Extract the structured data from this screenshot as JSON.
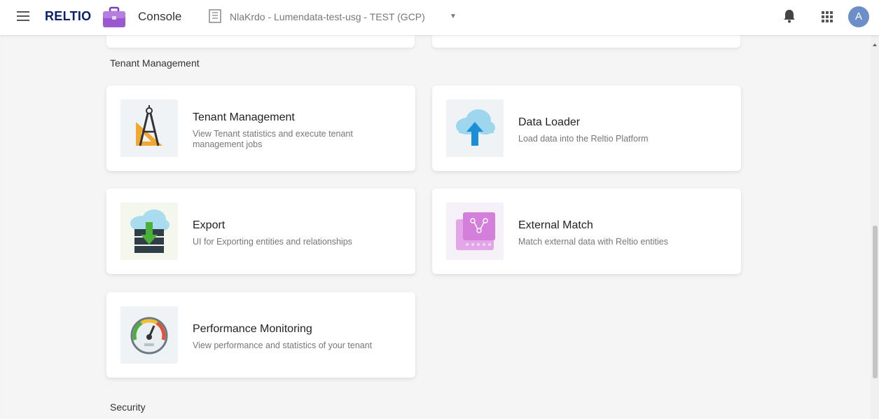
{
  "header": {
    "brand": "RELTIO",
    "app_name": "Console",
    "tenant_name": "NlaKrdo - Lumendata-test-usg - TEST (GCP)",
    "avatar_initial": "A"
  },
  "sections": [
    {
      "title": "Tenant Management",
      "cards": [
        {
          "title": "Tenant Management",
          "description": "View Tenant statistics and execute tenant management jobs",
          "icon": "compass-ruler-icon"
        },
        {
          "title": "Data Loader",
          "description": "Load data into the Reltio Platform",
          "icon": "cloud-upload-icon"
        },
        {
          "title": "Export",
          "description": "UI for Exporting entities and relationships",
          "icon": "server-download-icon"
        },
        {
          "title": "External Match",
          "description": "Match external data with Reltio entities",
          "icon": "match-grid-icon"
        },
        {
          "title": "Performance Monitoring",
          "description": "View performance and statistics of your tenant",
          "icon": "speedometer-icon"
        }
      ]
    },
    {
      "title": "Security"
    }
  ],
  "colors": {
    "brand": "#0a1f6b",
    "accent_purple": "#9b59d0",
    "card_bg": "#ffffff",
    "page_bg": "#f5f5f5"
  }
}
